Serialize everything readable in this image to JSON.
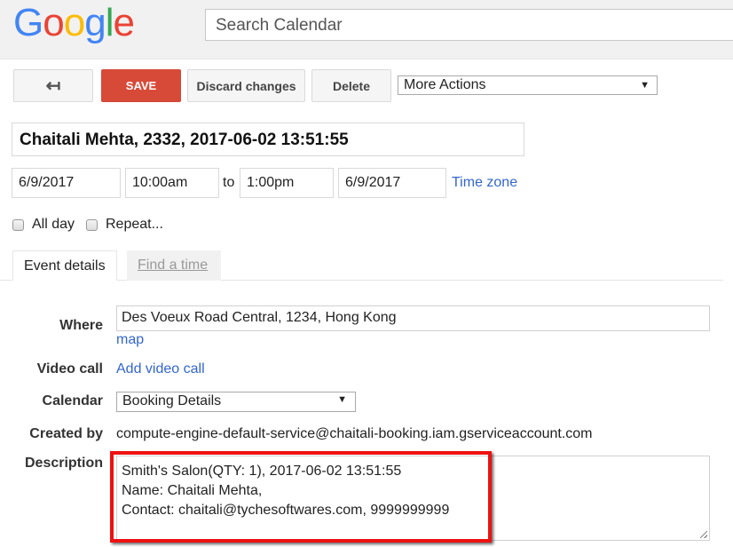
{
  "header": {
    "logo_letters": [
      {
        "ch": "G",
        "color": "#4285f4"
      },
      {
        "ch": "o",
        "color": "#ea4335"
      },
      {
        "ch": "o",
        "color": "#fbbc05"
      },
      {
        "ch": "g",
        "color": "#4285f4"
      },
      {
        "ch": "l",
        "color": "#34a853"
      },
      {
        "ch": "e",
        "color": "#ea4335"
      }
    ],
    "search_placeholder": "Search Calendar"
  },
  "toolbar": {
    "back_icon": "back-arrow-icon",
    "back_glyph": "↤",
    "save_label": "SAVE",
    "discard_label": "Discard changes",
    "delete_label": "Delete",
    "more_actions_label": "More Actions",
    "dropdown_arrow": "▼",
    "save_color": "#d84a38"
  },
  "event": {
    "title": "Chaitali Mehta, 2332, 2017-06-02 13:51:55",
    "start_date": "6/9/2017",
    "start_time": "10:00am",
    "to_label": "to",
    "end_time": "1:00pm",
    "end_date": "6/9/2017",
    "time_zone_label": "Time zone",
    "all_day_label": "All day",
    "all_day_checked": false,
    "repeat_label": "Repeat...",
    "repeat_checked": false
  },
  "tabs": [
    {
      "label": "Event details",
      "active": true
    },
    {
      "label": "Find a time",
      "active": false
    }
  ],
  "details": {
    "where_label": "Where",
    "where_value": "Des Voeux Road Central, 1234, Hong Kong",
    "map_link": "map",
    "video_label": "Video call",
    "video_link": "Add video call",
    "calendar_label": "Calendar",
    "calendar_value": "Booking Details",
    "created_label": "Created by",
    "created_value": "compute-engine-default-service@chaitali-booking.iam.gserviceaccount.com",
    "description_label": "Description",
    "description_lines": [
      "Smith's Salon(QTY: 1), 2017-06-02 13:51:55",
      "Name: Chaitali Mehta,",
      "Contact: chaitali@tychesoftwares.com, 9999999999"
    ]
  },
  "colors": {
    "link": "#3366cc",
    "highlight_box": "#ee1111"
  }
}
